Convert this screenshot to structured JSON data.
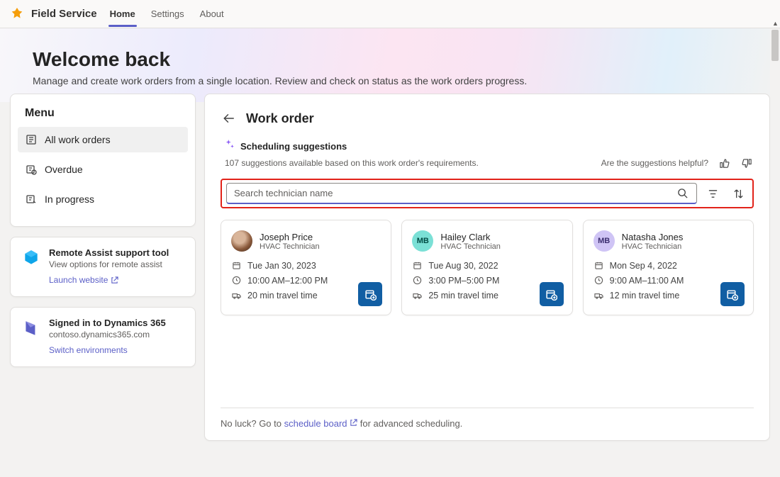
{
  "app": {
    "name": "Field Service"
  },
  "nav": {
    "tabs": [
      {
        "label": "Home",
        "active": true
      },
      {
        "label": "Settings",
        "active": false
      },
      {
        "label": "About",
        "active": false
      }
    ]
  },
  "hero": {
    "title": "Welcome back",
    "subtitle": "Manage and create work orders from a single location. Review and check on status as the work orders progress."
  },
  "menu": {
    "title": "Menu",
    "items": [
      {
        "label": "All work orders",
        "active": true,
        "icon": "list"
      },
      {
        "label": "Overdue",
        "active": false,
        "icon": "clock-alert"
      },
      {
        "label": "In progress",
        "active": false,
        "icon": "truck"
      }
    ]
  },
  "info_cards": [
    {
      "title": "Remote Assist support tool",
      "subtitle": "View options for remote assist",
      "link_label": "Launch website",
      "icon_color": "#0ea5e9"
    },
    {
      "title": "Signed in to Dynamics 365",
      "subtitle": "contoso.dynamics365.com",
      "link_label": "Switch environments",
      "icon_color": "#5b5fc7"
    }
  ],
  "work_order": {
    "page_title": "Work order",
    "suggestions_title": "Scheduling suggestions",
    "suggestions_sub": "107 suggestions available based on this work order's requirements.",
    "feedback_question": "Are the suggestions helpful?",
    "search_placeholder": "Search technician name",
    "footer_text_a": "No luck? Go to ",
    "footer_link": "schedule board",
    "footer_text_b": " for advanced scheduling."
  },
  "technicians": [
    {
      "name": "Joseph Price",
      "role": "HVAC Technician",
      "date": "Tue Jan 30, 2023",
      "time": "10:00 AM–12:00 PM",
      "travel": "20 min travel time",
      "avatar_class": "av-photo",
      "initials": ""
    },
    {
      "name": "Hailey Clark",
      "role": "HVAC Technician",
      "date": "Tue Aug 30, 2022",
      "time": "3:00 PM–5:00 PM",
      "travel": "25 min travel time",
      "avatar_class": "av-mb1",
      "initials": "MB"
    },
    {
      "name": "Natasha Jones",
      "role": "HVAC Technician",
      "date": "Mon Sep 4, 2022",
      "time": "9:00 AM–11:00 AM",
      "travel": "12 min travel time",
      "avatar_class": "av-mb2",
      "initials": "MB"
    }
  ]
}
